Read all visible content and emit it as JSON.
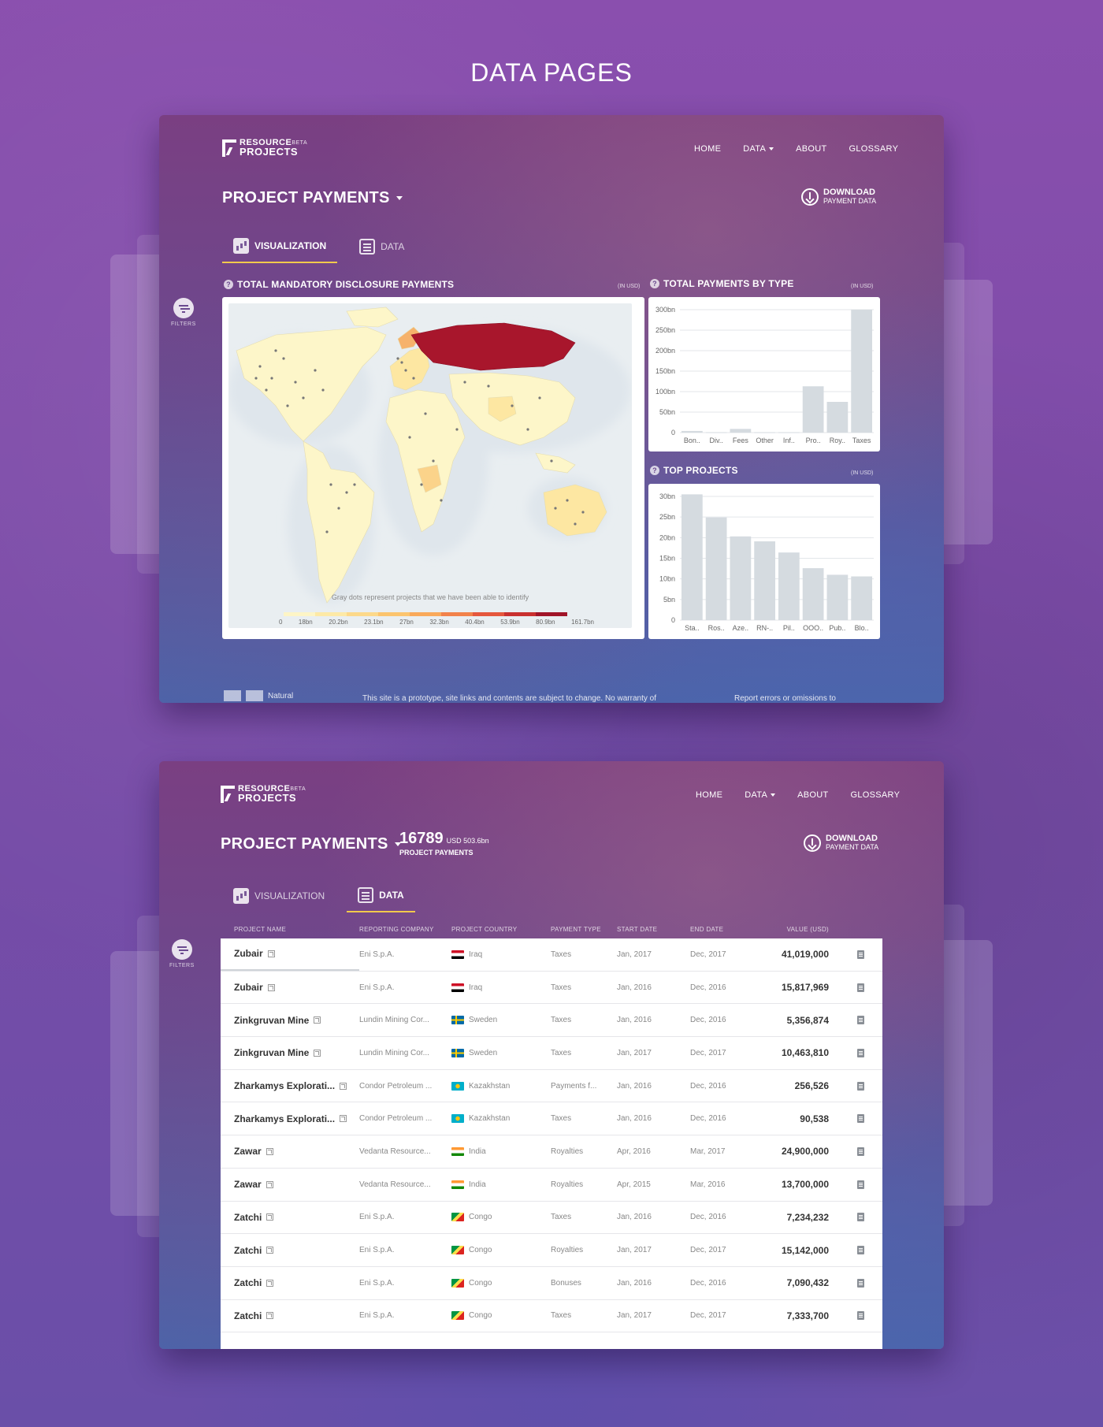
{
  "page": {
    "heading": "DATA PAGES"
  },
  "header": {
    "logo_line1": "RESOURCE",
    "logo_line2": "PROJECTS",
    "logo_beta": "BETA",
    "nav": {
      "home": "HOME",
      "data": "DATA",
      "about": "ABOUT",
      "glossary": "GLOSSARY"
    },
    "download_line1": "DOWNLOAD",
    "download_line2": "PAYMENT DATA"
  },
  "title": "PROJECT PAYMENTS",
  "tabs": {
    "visualization": "VISUALIZATION",
    "data": "DATA"
  },
  "filters_label": "FILTERS",
  "screen1": {
    "map_panel": {
      "title": "TOTAL MANDATORY DISCLOSURE PAYMENTS",
      "unit": "(IN USD)",
      "note": "Gray dots represent projects that we have been able to identify",
      "legend_labels": [
        "0",
        "18bn",
        "20.2bn",
        "23.1bn",
        "27bn",
        "32.3bn",
        "40.4bn",
        "53.9bn",
        "80.9bn",
        "161.7bn"
      ],
      "legend_colors": [
        "#fdf5c6",
        "#fde9a6",
        "#fcd98a",
        "#fbc46e",
        "#f9a95a",
        "#f2824a",
        "#e5573d",
        "#c9302f",
        "#a01428"
      ]
    },
    "types_panel": {
      "title": "TOTAL PAYMENTS BY TYPE",
      "unit": "(IN USD)"
    },
    "top_panel": {
      "title": "TOP PROJECTS",
      "unit": "(IN USD)"
    },
    "footer": {
      "partner": "Natural",
      "disclaimer": "This site is a prototype, site links and contents are subject to change. No warranty of",
      "report": "Report errors or omissions to"
    }
  },
  "chart_data": [
    {
      "type": "bar",
      "title": "TOTAL PAYMENTS BY TYPE",
      "categories": [
        "Bon..",
        "Div..",
        "Fees",
        "Other",
        "Inf..",
        "Pro..",
        "Roy..",
        "Taxes"
      ],
      "values": [
        4,
        1,
        9,
        1,
        1,
        113,
        75,
        300
      ],
      "yticks": [
        "0",
        "50bn",
        "100bn",
        "150bn",
        "200bn",
        "250bn",
        "300bn"
      ],
      "ylim": [
        0,
        300
      ],
      "unit": "bn"
    },
    {
      "type": "bar",
      "title": "TOP PROJECTS",
      "categories": [
        "Sta..",
        "Ros..",
        "Aze..",
        "RN-..",
        "Pil..",
        "OOO..",
        "Pub..",
        "Blo.."
      ],
      "values": [
        30.5,
        24.9,
        20.3,
        19.1,
        16.4,
        12.6,
        11.0,
        10.6
      ],
      "yticks": [
        "0",
        "5bn",
        "10bn",
        "15bn",
        "20bn",
        "25bn",
        "30bn"
      ],
      "ylim": [
        0,
        30
      ],
      "unit": "bn"
    }
  ],
  "screen2": {
    "count": "16789",
    "usd_total": "USD 503.6bn",
    "count_label": "PROJECT PAYMENTS",
    "columns": [
      "PROJECT NAME",
      "REPORTING COMPANY",
      "PROJECT COUNTRY",
      "PAYMENT TYPE",
      "START DATE",
      "END DATE",
      "VALUE (USD)"
    ],
    "rows": [
      {
        "name": "Zubair",
        "company": "Eni S.p.A.",
        "country": "Iraq",
        "flag": "iraq",
        "type": "Taxes",
        "start": "Jan, 2017",
        "end": "Dec, 2017",
        "value": "41,019,000"
      },
      {
        "name": "Zubair",
        "company": "Eni S.p.A.",
        "country": "Iraq",
        "flag": "iraq",
        "type": "Taxes",
        "start": "Jan, 2016",
        "end": "Dec, 2016",
        "value": "15,817,969"
      },
      {
        "name": "Zinkgruvan Mine",
        "company": "Lundin Mining Cor...",
        "country": "Sweden",
        "flag": "sweden",
        "type": "Taxes",
        "start": "Jan, 2016",
        "end": "Dec, 2016",
        "value": "5,356,874"
      },
      {
        "name": "Zinkgruvan Mine",
        "company": "Lundin Mining Cor...",
        "country": "Sweden",
        "flag": "sweden",
        "type": "Taxes",
        "start": "Jan, 2017",
        "end": "Dec, 2017",
        "value": "10,463,810"
      },
      {
        "name": "Zharkamys Explorati...",
        "company": "Condor Petroleum ...",
        "country": "Kazakhstan",
        "flag": "kazakhstan",
        "type": "Payments f...",
        "start": "Jan, 2016",
        "end": "Dec, 2016",
        "value": "256,526"
      },
      {
        "name": "Zharkamys Explorati...",
        "company": "Condor Petroleum ...",
        "country": "Kazakhstan",
        "flag": "kazakhstan",
        "type": "Taxes",
        "start": "Jan, 2016",
        "end": "Dec, 2016",
        "value": "90,538"
      },
      {
        "name": "Zawar",
        "company": "Vedanta Resource...",
        "country": "India",
        "flag": "india",
        "type": "Royalties",
        "start": "Apr, 2016",
        "end": "Mar, 2017",
        "value": "24,900,000"
      },
      {
        "name": "Zawar",
        "company": "Vedanta Resource...",
        "country": "India",
        "flag": "india",
        "type": "Royalties",
        "start": "Apr, 2015",
        "end": "Mar, 2016",
        "value": "13,700,000"
      },
      {
        "name": "Zatchi",
        "company": "Eni S.p.A.",
        "country": "Congo",
        "flag": "congo",
        "type": "Taxes",
        "start": "Jan, 2016",
        "end": "Dec, 2016",
        "value": "7,234,232"
      },
      {
        "name": "Zatchi",
        "company": "Eni S.p.A.",
        "country": "Congo",
        "flag": "congo",
        "type": "Royalties",
        "start": "Jan, 2017",
        "end": "Dec, 2017",
        "value": "15,142,000"
      },
      {
        "name": "Zatchi",
        "company": "Eni S.p.A.",
        "country": "Congo",
        "flag": "congo",
        "type": "Bonuses",
        "start": "Jan, 2016",
        "end": "Dec, 2016",
        "value": "7,090,432"
      },
      {
        "name": "Zatchi",
        "company": "Eni S.p.A.",
        "country": "Congo",
        "flag": "congo",
        "type": "Taxes",
        "start": "Jan, 2017",
        "end": "Dec, 2017",
        "value": "7,333,700"
      }
    ]
  }
}
